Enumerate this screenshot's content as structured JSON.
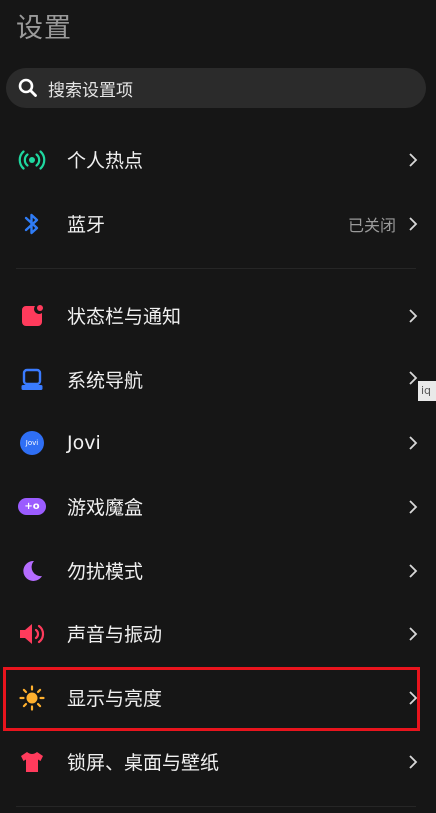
{
  "header": {
    "title": "设置"
  },
  "search": {
    "placeholder": "搜索设置项"
  },
  "items": [
    {
      "label": "个人热点",
      "value": "",
      "icon": "hotspot-icon"
    },
    {
      "label": "蓝牙",
      "value": "已关闭",
      "icon": "bluetooth-icon"
    },
    {
      "label": "状态栏与通知",
      "value": "",
      "icon": "status-bar-icon"
    },
    {
      "label": "系统导航",
      "value": "",
      "icon": "navigation-icon"
    },
    {
      "label": "Jovi",
      "value": "",
      "icon": "jovi-icon"
    },
    {
      "label": "游戏魔盒",
      "value": "",
      "icon": "gamepad-icon"
    },
    {
      "label": "勿扰模式",
      "value": "",
      "icon": "moon-icon"
    },
    {
      "label": "声音与振动",
      "value": "",
      "icon": "speaker-icon"
    },
    {
      "label": "显示与亮度",
      "value": "",
      "icon": "sun-icon"
    },
    {
      "label": "锁屏、桌面与壁纸",
      "value": "",
      "icon": "tshirt-icon"
    }
  ],
  "icon_text": {
    "jovi": "Jovi",
    "game": "+o"
  },
  "tooltip": {
    "text": "iq"
  },
  "colors": {
    "hotspot": "#1fd8a0",
    "bluetooth": "#2f7cf6",
    "status_bar": "#ff3b5c",
    "navigation": "#3a7bff",
    "jovi": "#2f6ff5",
    "game": "#9b5cff",
    "moon": "#b56cff",
    "speaker": "#ff3b5c",
    "sun": "#ffb02e",
    "tshirt": "#ff3b5c",
    "highlight": "#e8141d"
  }
}
